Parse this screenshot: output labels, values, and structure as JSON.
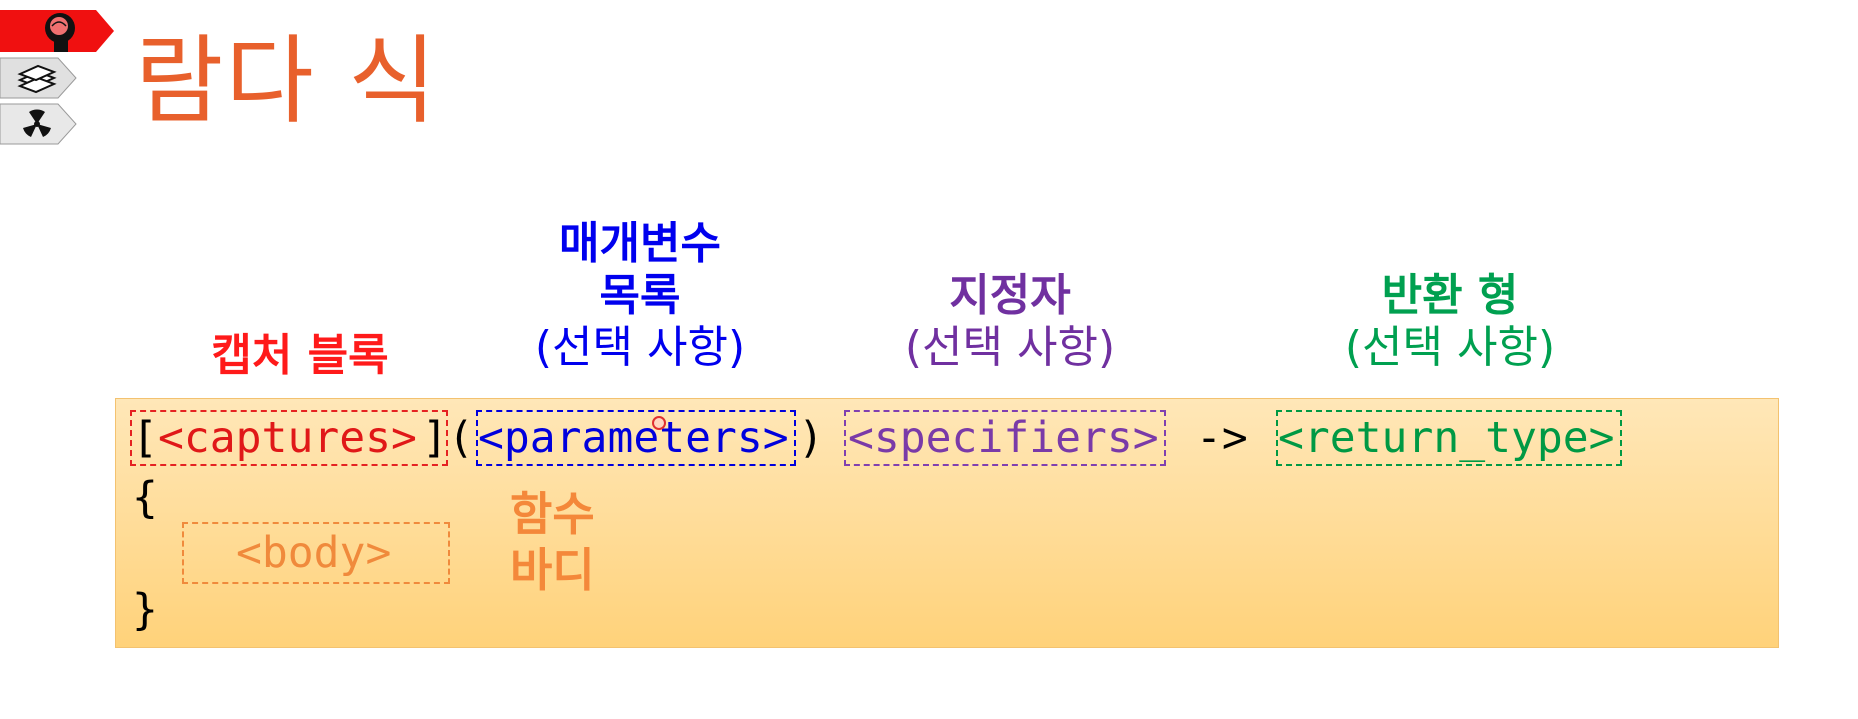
{
  "title": "람다 식",
  "side_icons": [
    "brain-head-icon",
    "book-stack-icon",
    "radiation-icon"
  ],
  "labels": {
    "capture": {
      "head": "캡처 블록"
    },
    "parameters": {
      "head_line1": "매개변수",
      "head_line2": "목록",
      "sub": "(선택 사항)"
    },
    "specifiers": {
      "head": "지정자",
      "sub": "(선택 사항)"
    },
    "return_type": {
      "head": "반환 형",
      "sub": "(선택 사항)"
    },
    "body": {
      "line1": "함수",
      "line2": "바디"
    }
  },
  "code": {
    "open_bracket": "[",
    "captures": "<captures>",
    "close_bracket_paren": "](",
    "parameters": "<parameters>",
    "close_paren": ")",
    "specifiers": "<specifiers>",
    "arrow": "->",
    "return_type": "<return_type>",
    "open_brace": "{",
    "body": "<body>",
    "close_brace": "}"
  },
  "colors": {
    "title": "#e8602c",
    "capture": "#ff1a1a",
    "parameters": "#0000ee",
    "specifiers": "#7030a0",
    "return_type": "#00a050",
    "body": "#f4883a",
    "code_background": "#ffd27a"
  }
}
